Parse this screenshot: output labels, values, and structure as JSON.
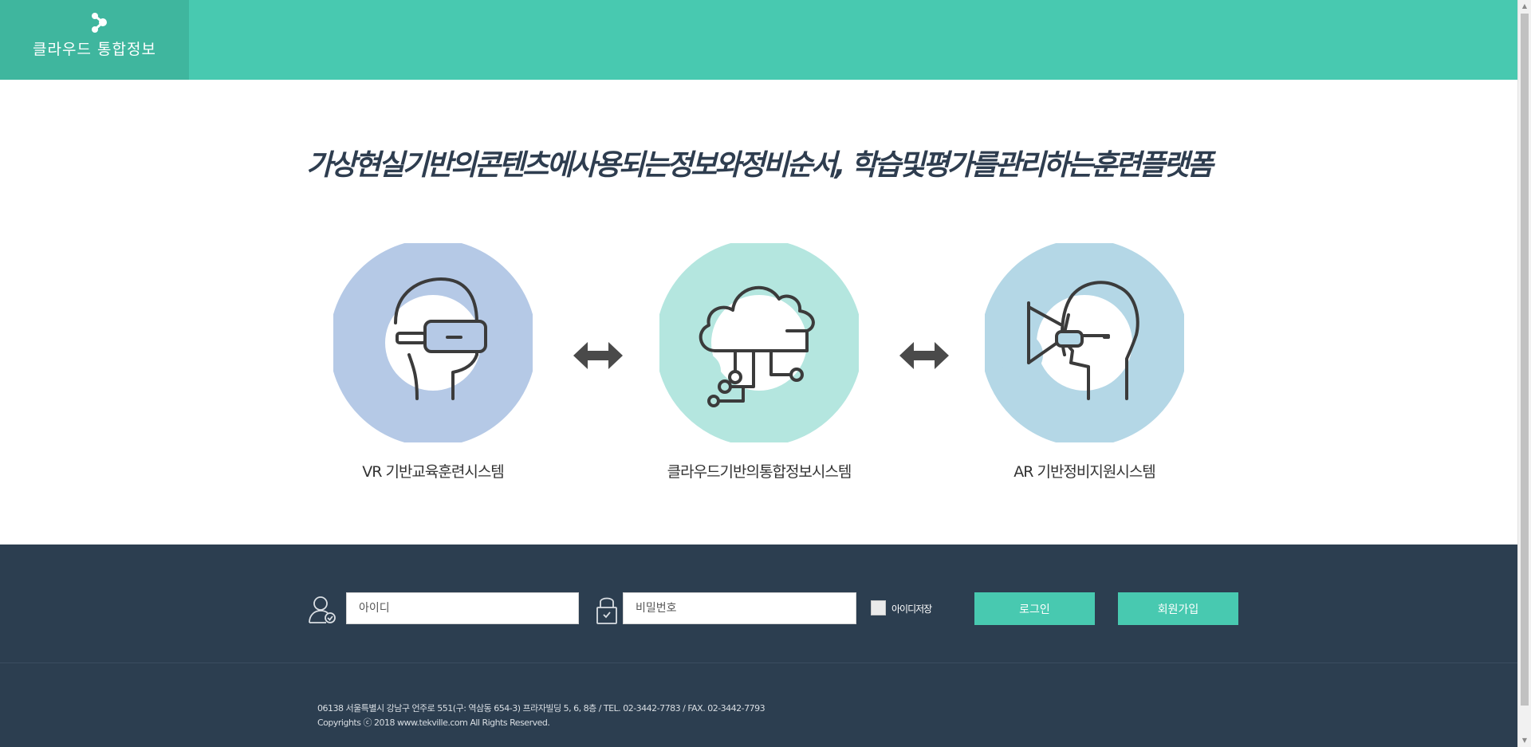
{
  "header": {
    "title": "클라우드 통합정보",
    "logo_icon": "logo-icon"
  },
  "main": {
    "headline": "가상현실기반의콘텐츠에사용되는정보와정비순서, 학습및평가를관리하는훈련플랫폼",
    "features": [
      {
        "label": "VR 기반교육훈련시스템",
        "icon": "vr-headset-icon",
        "accent": "#b5c9e6"
      },
      {
        "label": "클라우드기반의통합정보시스템",
        "icon": "cloud-network-icon",
        "accent": "#b4e6df"
      },
      {
        "label": "AR 기반정비지원시스템",
        "icon": "ar-glasses-icon",
        "accent": "#b4d7e6"
      }
    ],
    "connector_icon": "double-arrow-icon"
  },
  "login": {
    "id_placeholder": "아이디",
    "pw_placeholder": "비밀번호",
    "save_id_label": "아이디저장",
    "login_label": "로그인",
    "signup_label": "회원가입"
  },
  "footer": {
    "address": "06138 서울특별시 강남구 언주로 551(구: 역삼동 654-3) 프라자빌딩 5, 6, 8층 / TEL. 02-3442-7783 / FAX. 02-3442-7793",
    "copyright": "Copyrights ⓒ 2018 www.tekville.com All Rights Reserved."
  },
  "colors": {
    "brand": "#48c9b0",
    "brand_dark": "#3fb69e",
    "navy": "#2c3e50",
    "headline": "#2e3d4f",
    "icon_stroke": "#3b3b3b"
  }
}
